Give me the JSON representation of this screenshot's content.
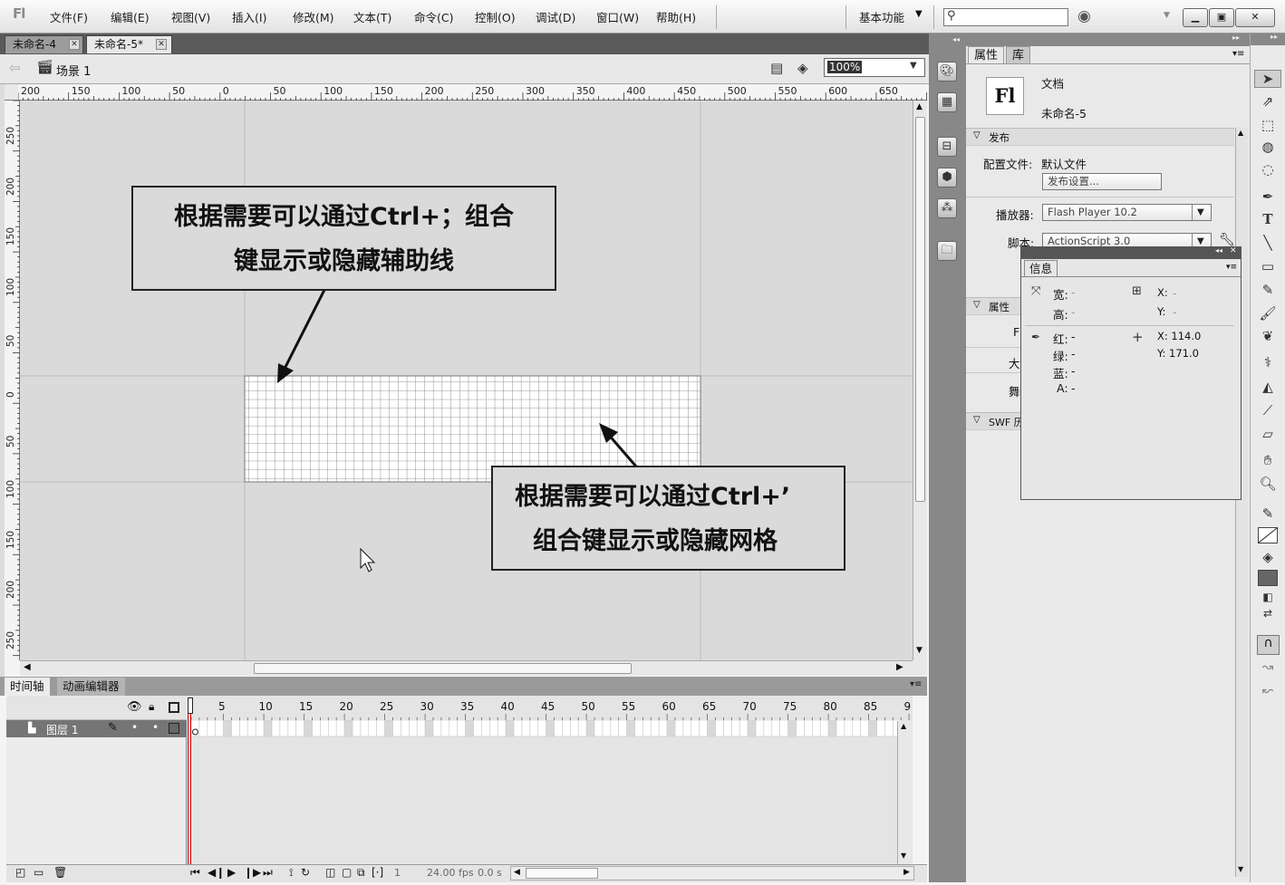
{
  "menubar": {
    "logo": "Fl",
    "items": [
      "文件(F)",
      "编辑(E)",
      "视图(V)",
      "插入(I)",
      "修改(M)",
      "文本(T)",
      "命令(C)",
      "控制(O)",
      "调试(D)",
      "窗口(W)",
      "帮助(H)"
    ],
    "workspace": "基本功能",
    "search_placeholder": ""
  },
  "doc_tabs": [
    {
      "label": "未命名-4"
    },
    {
      "label": "未命名-5*"
    }
  ],
  "edit_bar": {
    "scene": "场景 1",
    "zoom": "100%"
  },
  "h_ruler": [
    "200",
    "150",
    "100",
    "50",
    "0",
    "50",
    "100",
    "150",
    "200",
    "250",
    "300",
    "350",
    "400",
    "450",
    "500",
    "550",
    "600",
    "650"
  ],
  "v_ruler": [
    "250",
    "200",
    "150",
    "100",
    "50",
    "0",
    "50",
    "100",
    "150",
    "200",
    "250"
  ],
  "annotations": {
    "top": [
      "根据需要可以通过Ctrl+；组合",
      "键显示或隐藏辅助线"
    ],
    "bottom": [
      "根据需要可以通过Ctrl+’",
      "组合键显示或隐藏网格"
    ]
  },
  "timeline": {
    "tabs": [
      "时间轴",
      "动画编辑器"
    ],
    "frame_numbers": [
      "1",
      "5",
      "10",
      "15",
      "20",
      "25",
      "30",
      "35",
      "40",
      "45",
      "50",
      "55",
      "60",
      "65",
      "70",
      "75",
      "80",
      "85",
      "9"
    ],
    "layer_name": "图层 1",
    "current_frame": "1",
    "fps": "24.00 fps",
    "time": "0.0 s"
  },
  "properties": {
    "tabs": [
      "属性",
      "库"
    ],
    "doc_type": "文档",
    "doc_name": "未命名-5",
    "publish_section": "发布",
    "profile_label": "配置文件:",
    "profile_value": "默认文件",
    "publish_settings_button": "发布设置...",
    "player_label": "播放器:",
    "player_value": "Flash Player 10.2",
    "script_label": "脚本:",
    "script_value": "ActionScript 3.0",
    "props_section": "属性",
    "fps_label_cut": "F",
    "size_label_cut": "大",
    "stage_label_cut": "舞",
    "swf_section": "SWF 历"
  },
  "info_panel": {
    "title": "信息",
    "width_label": "宽:",
    "width_value": "-",
    "height_label": "高:",
    "height_value": "-",
    "x_label": "X:",
    "x_value": "-",
    "y_label": "Y:",
    "y_value": "-",
    "red_label": "红:",
    "red_value": "-",
    "green_label": "绿:",
    "green_value": "-",
    "blue_label": "蓝:",
    "blue_value": "-",
    "alpha_label": "A:",
    "alpha_value": "-",
    "cursor_x": "X: 114.0",
    "cursor_y": "Y: 171.0"
  }
}
